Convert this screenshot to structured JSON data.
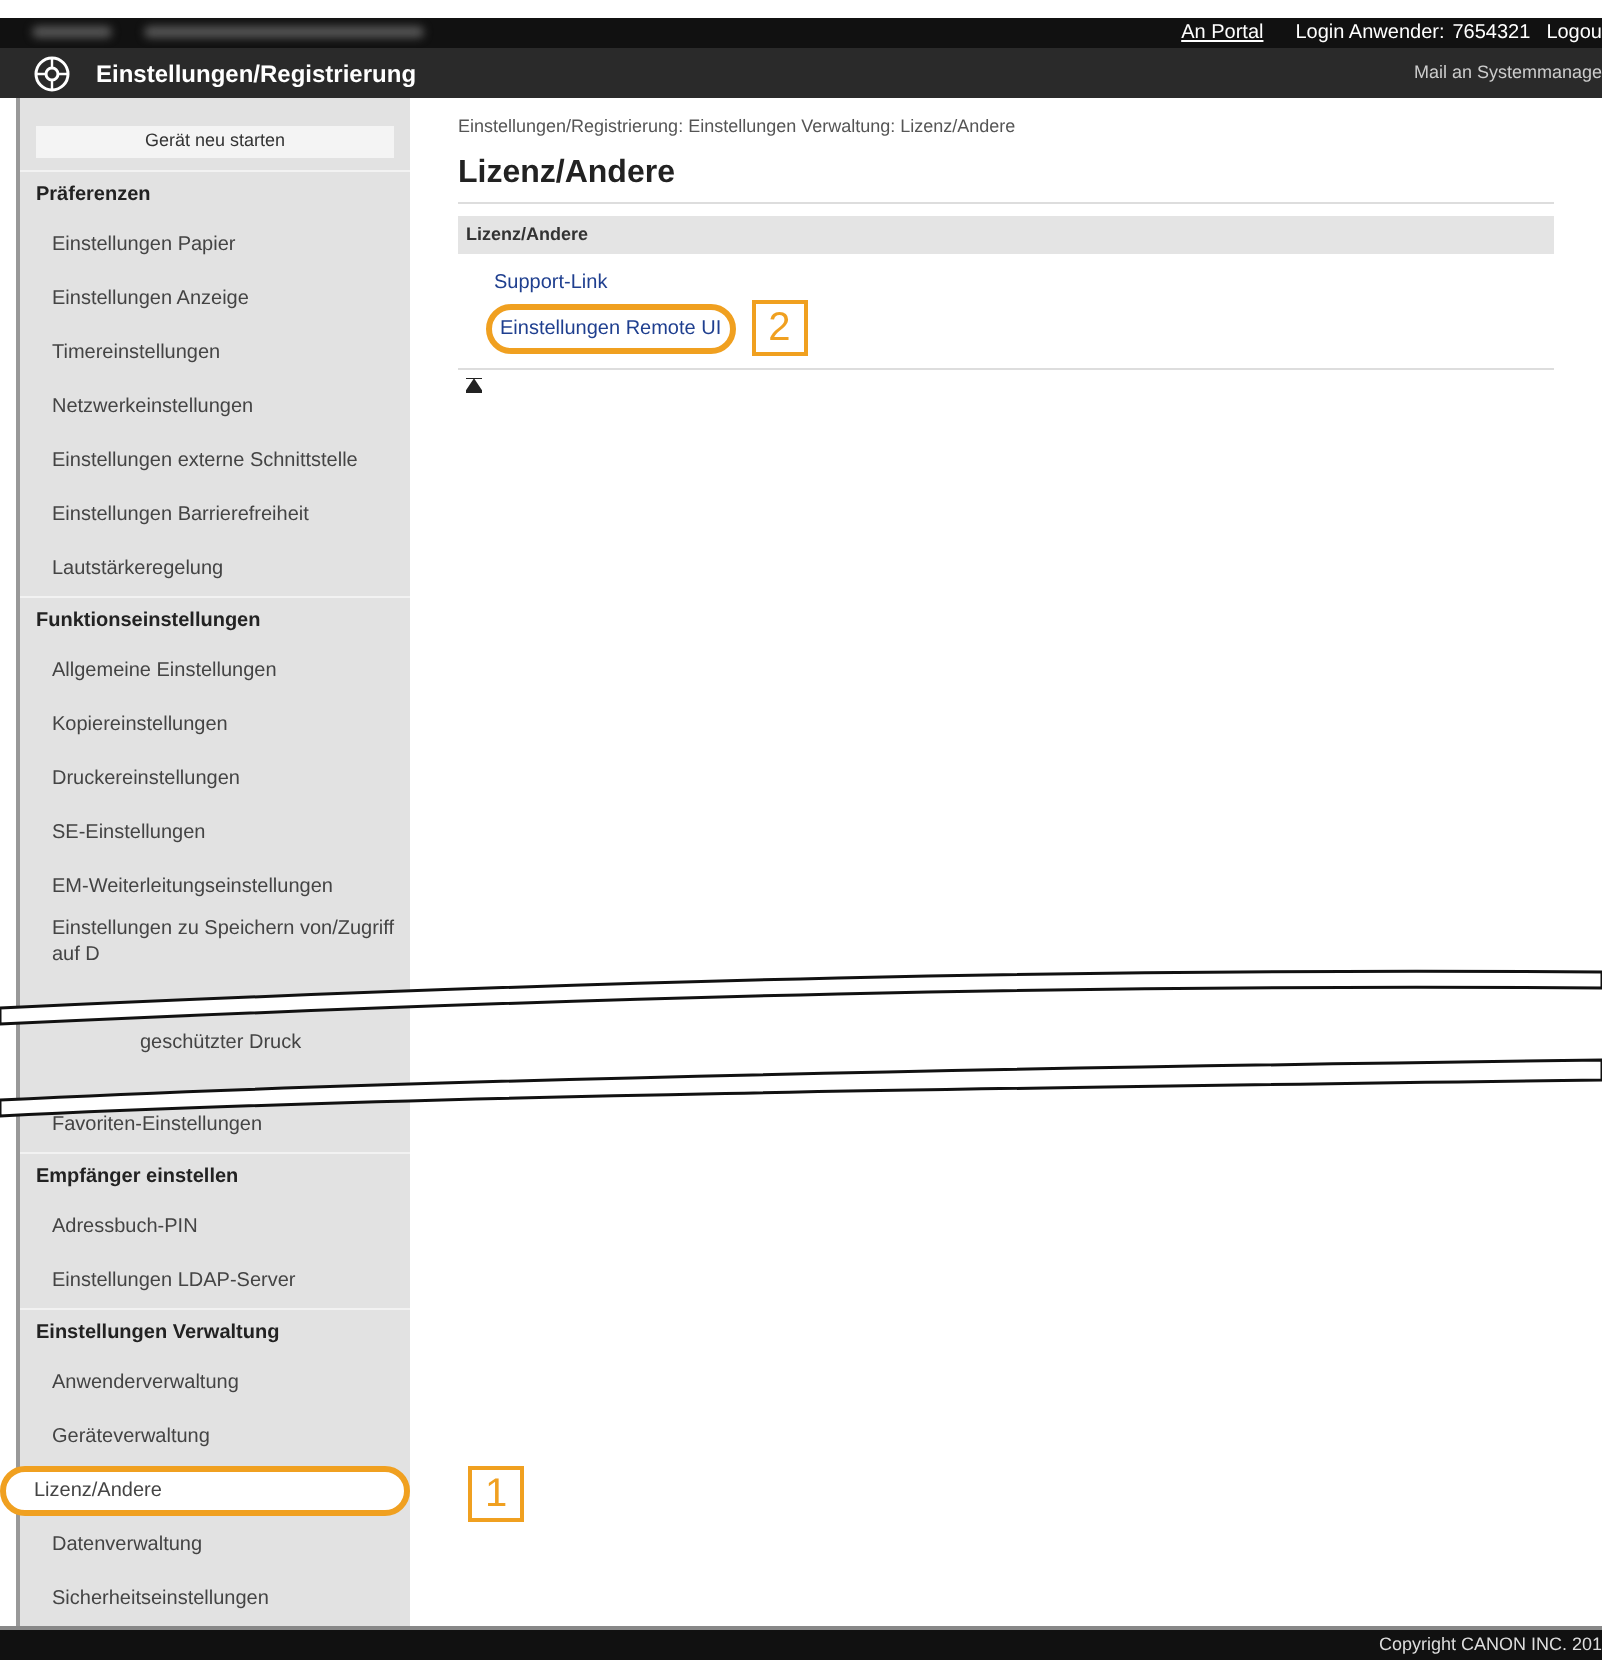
{
  "top_bar": {
    "portal_link": "An Portal",
    "login_label": "Login Anwender:",
    "login_user": "7654321",
    "logout_link": "Logou"
  },
  "header": {
    "title": "Einstellungen/Registrierung",
    "mail_link": "Mail an Systemmanage"
  },
  "sidebar": {
    "restart_button": "Gerät neu starten",
    "upper": [
      {
        "kind": "header",
        "text": "Präferenzen"
      },
      {
        "kind": "item",
        "text": "Einstellungen Papier",
        "selected": false
      },
      {
        "kind": "item",
        "text": "Einstellungen Anzeige",
        "selected": false
      },
      {
        "kind": "item",
        "text": "Timereinstellungen",
        "selected": false
      },
      {
        "kind": "item",
        "text": "Netzwerkeinstellungen",
        "selected": false
      },
      {
        "kind": "item",
        "text": "Einstellungen externe Schnittstelle",
        "selected": false
      },
      {
        "kind": "item",
        "text": "Einstellungen Barrierefreiheit",
        "selected": false
      },
      {
        "kind": "item",
        "text": "Lautstärkeregelung",
        "selected": false
      },
      {
        "kind": "header",
        "text": "Funktionseinstellungen"
      },
      {
        "kind": "item",
        "text": "Allgemeine Einstellungen",
        "selected": false
      },
      {
        "kind": "item",
        "text": "Kopiereinstellungen",
        "selected": false
      },
      {
        "kind": "item",
        "text": "Druckereinstellungen",
        "selected": false
      },
      {
        "kind": "item",
        "text": "SE-Einstellungen",
        "selected": false
      },
      {
        "kind": "item",
        "text": "EM-Weiterleitungseinstellungen",
        "selected": false
      },
      {
        "kind": "item",
        "text": "Einstellungen zu Speichern von/Zugriff auf D",
        "selected": false
      }
    ],
    "tear_fragment": "geschützter Druck",
    "lower": [
      {
        "kind": "item",
        "text": "Favoriten-Einstellungen",
        "selected": false
      },
      {
        "kind": "header",
        "text": "Empfänger einstellen"
      },
      {
        "kind": "item",
        "text": "Adressbuch-PIN",
        "selected": false
      },
      {
        "kind": "item",
        "text": "Einstellungen LDAP-Server",
        "selected": false
      },
      {
        "kind": "header",
        "text": "Einstellungen Verwaltung"
      },
      {
        "kind": "item",
        "text": "Anwenderverwaltung",
        "selected": false
      },
      {
        "kind": "item",
        "text": "Geräteverwaltung",
        "selected": false
      },
      {
        "kind": "item",
        "text": "Lizenz/Andere",
        "selected": true,
        "callout": "1"
      },
      {
        "kind": "item",
        "text": "Datenverwaltung",
        "selected": false
      },
      {
        "kind": "item",
        "text": "Sicherheitseinstellungen",
        "selected": false
      }
    ]
  },
  "main": {
    "breadcrumb": "Einstellungen/Registrierung: Einstellungen Verwaltung: Lizenz/Andere",
    "title": "Lizenz/Andere",
    "section_header": "Lizenz/Andere",
    "links": [
      {
        "text": "Support-Link"
      },
      {
        "text": "Einstellungen Remote UI",
        "callout": "2"
      }
    ]
  },
  "footer": {
    "copyright": "Copyright CANON INC. 201"
  }
}
